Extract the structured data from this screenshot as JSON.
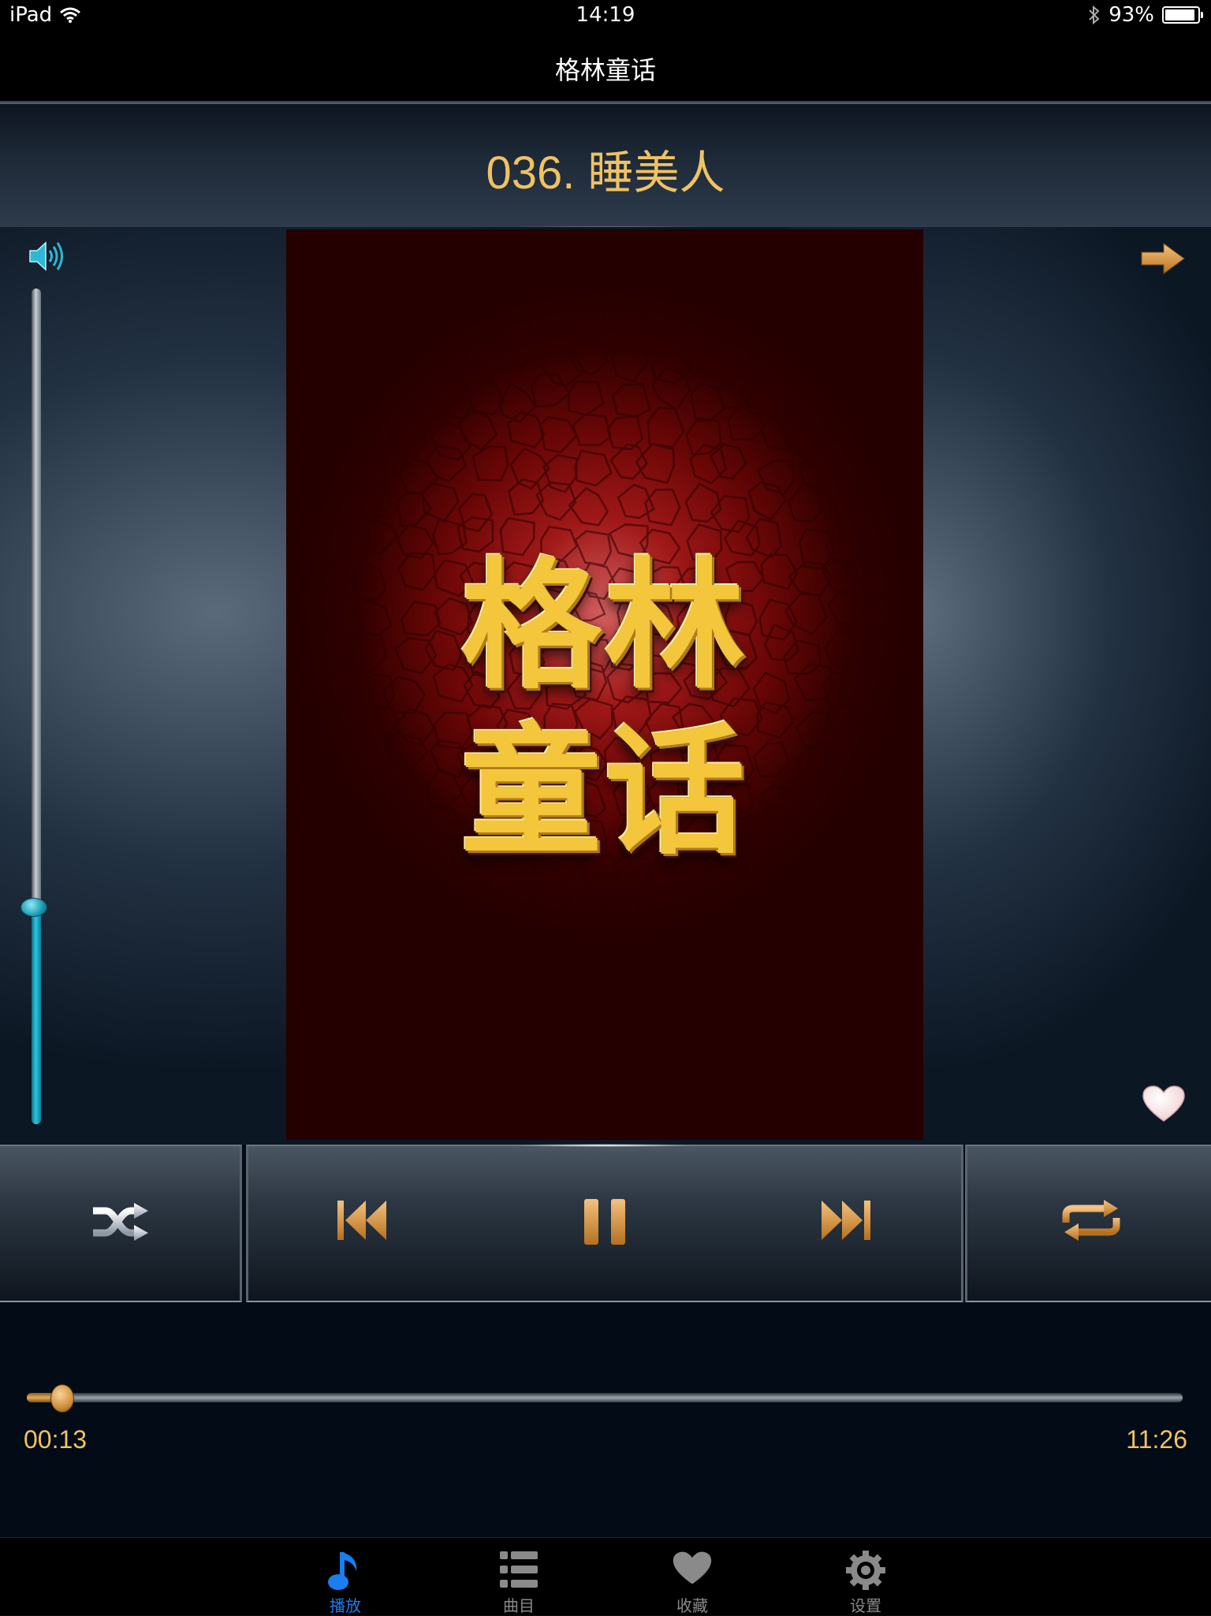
{
  "status_bar": {
    "device": "iPad",
    "time": "14:19",
    "battery": "93%",
    "battery_level": 0.93
  },
  "nav": {
    "title": "格林童话"
  },
  "now_playing": {
    "track_title": "036. 睡美人"
  },
  "album_art": {
    "line1": "格林",
    "line2": "童话"
  },
  "volume": {
    "level": 0.26
  },
  "playback": {
    "elapsed": "00:13",
    "total": "11:26",
    "progress": 0.019
  },
  "tabs": [
    {
      "label": "播放",
      "icon": "music-note-icon",
      "active": true
    },
    {
      "label": "曲目",
      "icon": "list-icon",
      "active": false
    },
    {
      "label": "收藏",
      "icon": "heart-icon",
      "active": false
    },
    {
      "label": "设置",
      "icon": "gear-icon",
      "active": false
    }
  ],
  "colors": {
    "accent": "#f0c264",
    "volume": "#2ac6e3",
    "tab_active": "#1a7ef0"
  }
}
